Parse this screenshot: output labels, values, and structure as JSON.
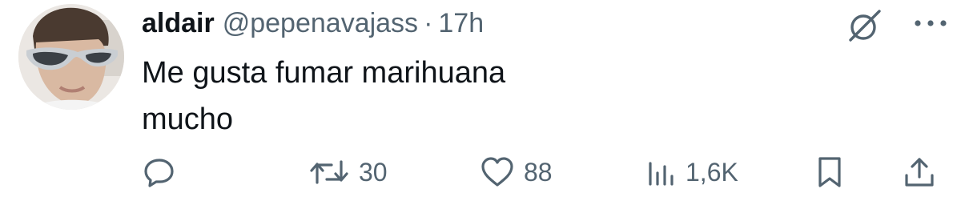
{
  "tweet": {
    "display_name": "aldair",
    "handle": "@pepenavajass",
    "separator": "·",
    "time": "17h",
    "text_lines": [
      "Me gusta fumar marihuana",
      "mucho"
    ]
  },
  "icons": {
    "grok": "grok-icon",
    "more": "more-icon",
    "reply": "reply-icon",
    "retweet": "retweet-icon",
    "like": "heart-icon",
    "views": "views-icon",
    "bookmark": "bookmark-icon",
    "share": "share-icon"
  },
  "metrics": {
    "retweets": "30",
    "likes": "88",
    "views": "1,6K"
  },
  "colors": {
    "text": "#0f1419",
    "secondary": "#536471"
  }
}
